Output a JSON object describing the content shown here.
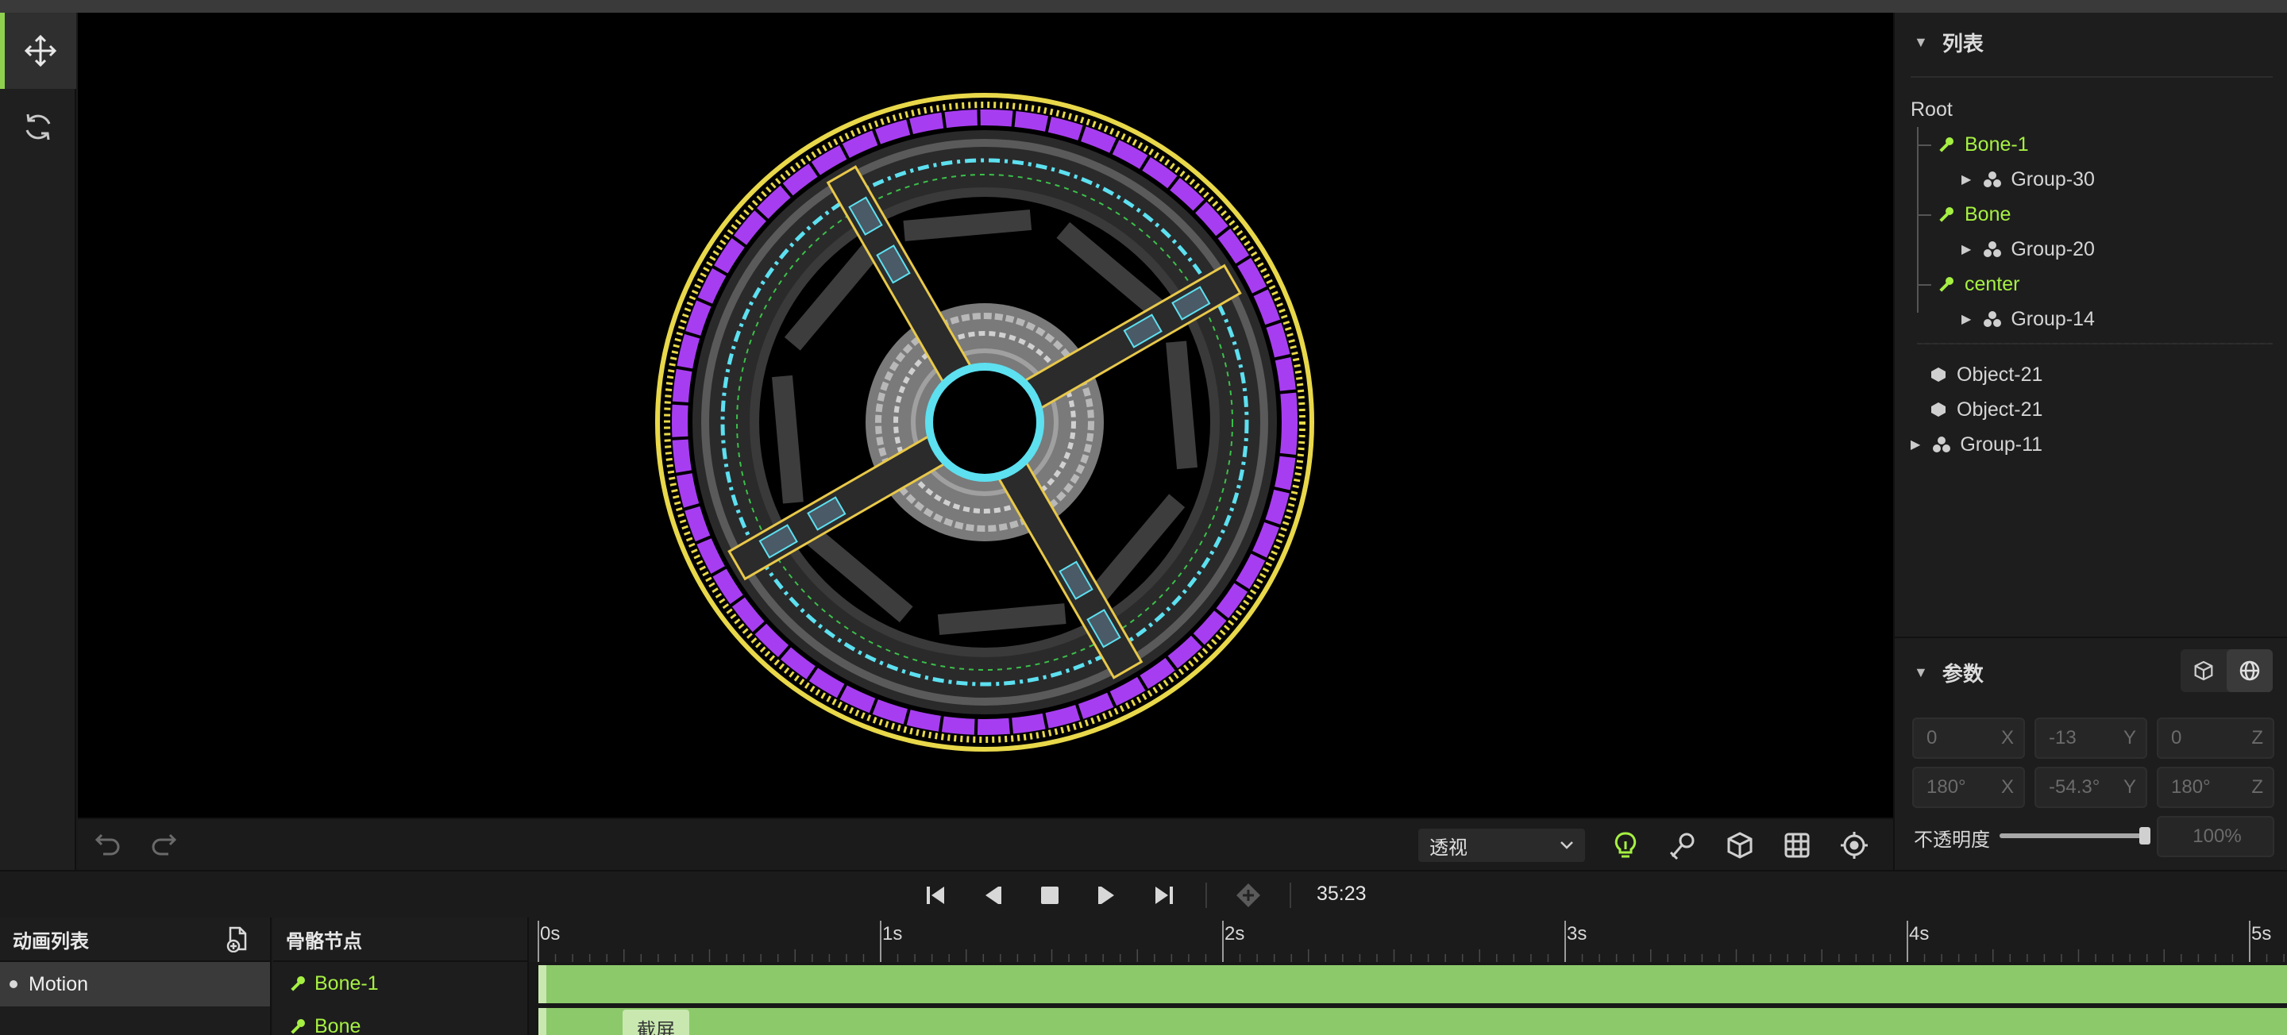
{
  "tools": [
    {
      "name": "move-icon",
      "active": true
    },
    {
      "name": "rotate-icon",
      "active": false
    }
  ],
  "viewport": {
    "view_mode": "透视",
    "toolbar_icons": [
      "lightbulb-icon",
      "bone-pen-icon",
      "cube-icon",
      "grid-icon",
      "target-icon"
    ],
    "history_icons": [
      "undo-icon",
      "redo-icon"
    ]
  },
  "list_panel": {
    "title": "列表",
    "root": "Root",
    "nodes": [
      {
        "label": "Bone-1",
        "type": "bone"
      },
      {
        "label": "Group-30",
        "type": "group"
      },
      {
        "label": "Bone",
        "type": "bone"
      },
      {
        "label": "Group-20",
        "type": "group"
      },
      {
        "label": "center",
        "type": "bone"
      },
      {
        "label": "Group-14",
        "type": "group"
      },
      {
        "label": "Object-21",
        "type": "object"
      },
      {
        "label": "Object-21",
        "type": "object"
      },
      {
        "label": "Group-11",
        "type": "group"
      }
    ]
  },
  "params_panel": {
    "title": "参数",
    "position": {
      "x": "0",
      "y": "-13",
      "z": "0"
    },
    "rotation": {
      "x": "180°",
      "y": "-54.3°",
      "z": "180°"
    },
    "axis_labels": {
      "x": "X",
      "y": "Y",
      "z": "Z"
    },
    "opacity_label": "不透明度",
    "opacity_value": "100%",
    "opacity_fraction": 1.0
  },
  "transport": {
    "timecode": "35:23"
  },
  "animation_list": {
    "title": "动画列表",
    "items": [
      {
        "label": "Motion"
      }
    ]
  },
  "bone_nodes": {
    "title": "骨骼节点",
    "items": [
      {
        "label": "Bone-1"
      },
      {
        "label": "Bone"
      }
    ]
  },
  "timeline": {
    "ticks": [
      "0s",
      "1s",
      "2s",
      "3s",
      "4s",
      "5s"
    ],
    "tooltip": "截屏"
  },
  "colors": {
    "accent": "#a6f043",
    "track": "#8cc96a",
    "wheel_purple": "#a73df0",
    "wheel_yellow": "#e8d84a",
    "wheel_cyan": "#5de0f0"
  }
}
